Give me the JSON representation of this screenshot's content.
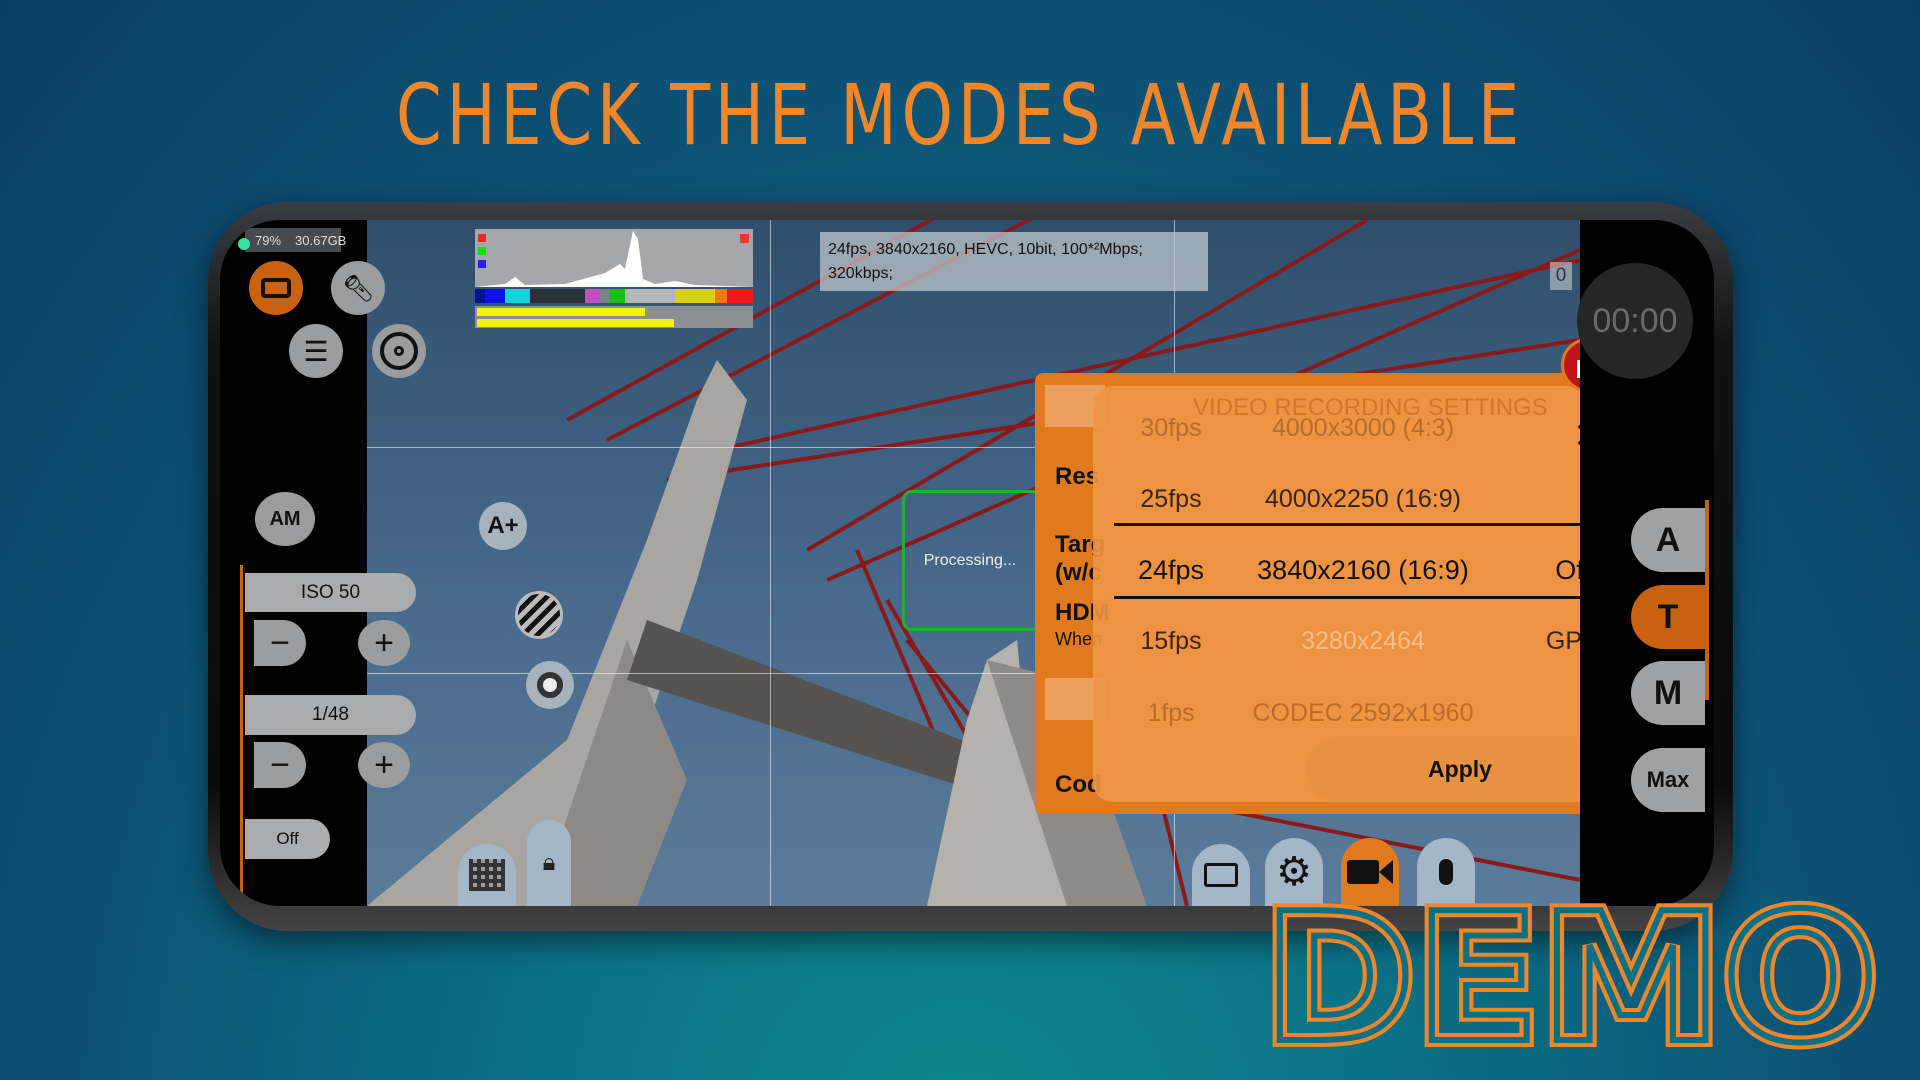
{
  "banner": {
    "title": "CHECK THE MODES AVAILABLE",
    "watermark": "DEMO"
  },
  "status": {
    "battery": "79%",
    "storage": "30.67GB"
  },
  "info": {
    "line1": "24fps, 3840x2160, HEVC, 10bit, 100*²Mbps;",
    "line2": "320kbps;",
    "counter": "0"
  },
  "timer": "00:00",
  "left_panel": {
    "iso": "ISO 50",
    "shutter": "1/48",
    "off": "Off",
    "minus": "−",
    "plus": "+",
    "am_label": "AM"
  },
  "viewfinder": {
    "processing": "Processing...",
    "af_icon_label": "A+"
  },
  "right_panel": {
    "modes": [
      "A",
      "T",
      "M"
    ],
    "max": "Max",
    "active_mode": "T"
  },
  "dialog": {
    "ghost_title": "VIDEO RECORDING SETTINGS",
    "side_labels": [
      "Res",
      "Targ",
      "(w/c",
      "HDM",
      "When",
      "Cod"
    ],
    "rows": [
      {
        "fps": "30fps",
        "resolution": "4000x3000 (4:3)",
        "extra": ""
      },
      {
        "fps": "25fps",
        "resolution": "4000x2250 (16:9)",
        "extra": ""
      },
      {
        "fps": "24fps",
        "resolution": "3840x2160 (16:9)",
        "extra": "Off"
      },
      {
        "fps": "15fps",
        "resolution": "3280x2464",
        "extra": "GPU"
      },
      {
        "fps": "1fps",
        "resolution": "CODEC 2592x1960",
        "extra": ""
      }
    ],
    "selected_index": 2,
    "apply": "Apply"
  },
  "colors": {
    "accent": "#f0862a",
    "dialog": "#e07a1c",
    "active": "#c85f10",
    "lock": "#c0141a",
    "processing_border": "#22b030"
  },
  "histogram": {
    "levels": [
      0.85,
      1.0
    ]
  }
}
